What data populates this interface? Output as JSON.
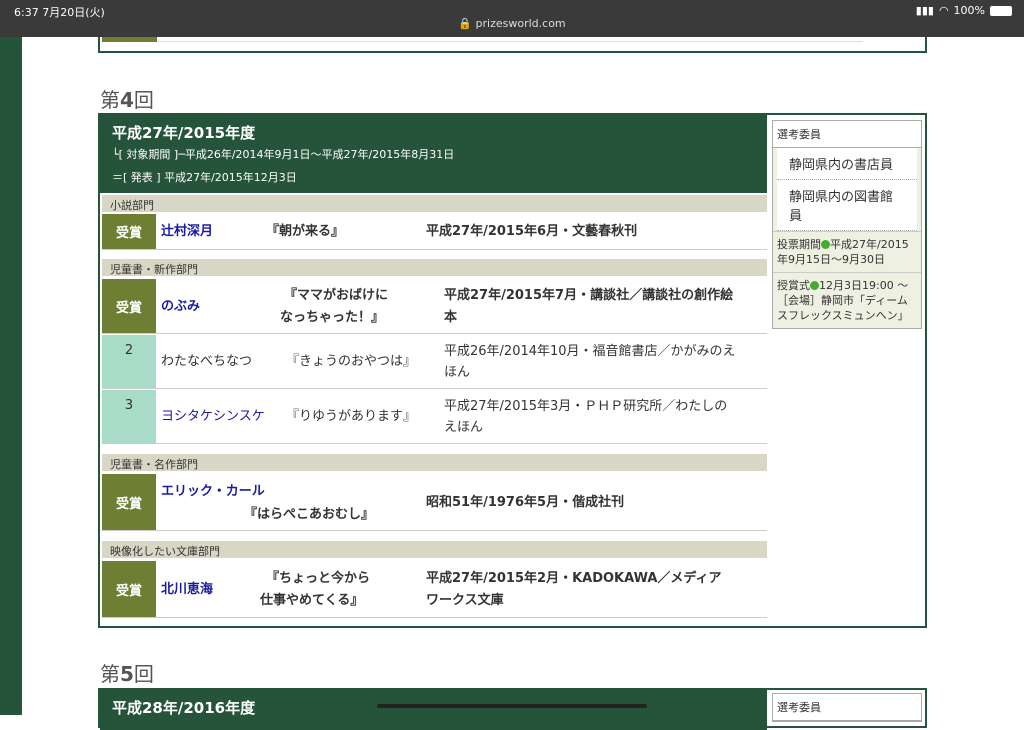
{
  "status": {
    "time": "6:37 7月20日(火)",
    "url": "prizesworld.com",
    "battery": "100%",
    "colors": {
      "bar": "#3a3a3a"
    }
  },
  "section4": {
    "heading_prefix": "第",
    "heading_num": "4",
    "heading_suffix": "回",
    "year": "平成27年/2015年度",
    "period": "└[ 対象期間 ]─平成26年/2014年9月1日～平成27年/2015年8月31日",
    "announce": "＝[ 発表 ] 平成27年/2015年12月3日",
    "side": {
      "title": "選考委員",
      "members": [
        "静岡県内の書店員",
        "静岡県内の図書館員"
      ],
      "vote_label": "投票期間",
      "vote_text": "平成27年/2015年9月15日～9月30日",
      "ceremony_label": "授賞式",
      "ceremony_text": "12月3日19:00 ～ ［会場］静岡市「ディームスフレックスミュンヘン」"
    },
    "categories": [
      {
        "name": "小説部門"
      },
      {
        "name": "児童書・新作部門"
      },
      {
        "name": "児童書・名作部門"
      },
      {
        "name": "映像化したい文庫部門"
      }
    ],
    "rows": [
      {
        "badge": "受賞",
        "author": "辻村深月",
        "title": "『朝が来る』",
        "pub": "平成27年/2015年6月・文藝春秋刊"
      },
      {
        "badge": "受賞",
        "author": "のぶみ",
        "title1": "『ママがおばけに",
        "title2": "なっちゃった！』",
        "pub1": "平成27年/2015年7月・講談社／講談社の創作絵",
        "pub2": "本"
      },
      {
        "badge": "2",
        "author": "わたなべちなつ",
        "title": "『きょうのおやつは』",
        "pub1": "平成26年/2014年10月・福音館書店／かがみのえ",
        "pub2": "ほん"
      },
      {
        "badge": "3",
        "author": "ヨシタケシンスケ",
        "title": "『りゆうがあります』",
        "pub1": "平成27年/2015年3月・ＰＨＰ研究所／わたしの",
        "pub2": "えほん"
      },
      {
        "badge": "受賞",
        "author": "エリック・カール",
        "title": "『はらぺこあおむし』",
        "pub": "昭和51年/1976年5月・偕成社刊"
      },
      {
        "badge": "受賞",
        "author": "北川恵海",
        "title1": "『ちょっと今から",
        "title2": "仕事やめてくる』",
        "pub1": "平成27年/2015年2月・KADOKAWA／メディア",
        "pub2": "ワークス文庫"
      }
    ]
  },
  "section5": {
    "heading_prefix": "第",
    "heading_num": "5",
    "heading_suffix": "回",
    "year": "平成28年/2016年度",
    "side_title": "選考委員"
  }
}
